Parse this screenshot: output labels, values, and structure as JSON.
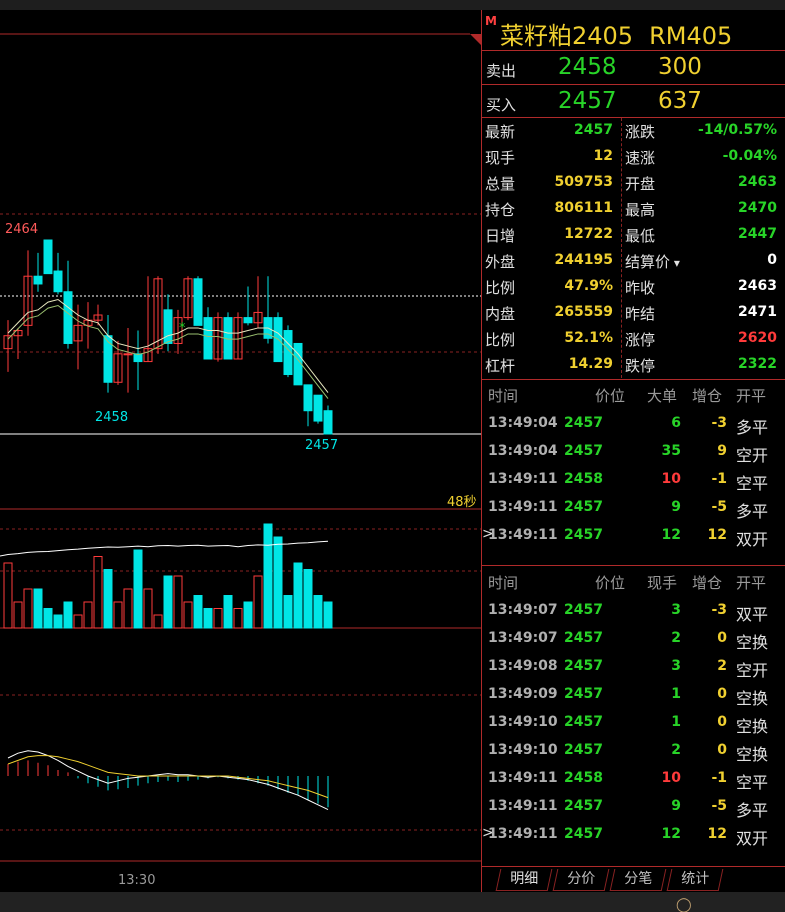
{
  "header": {
    "badge": "M",
    "name": "菜籽粕2405",
    "code": "RM405"
  },
  "quote": {
    "sell": {
      "label": "卖出",
      "price": "2458",
      "volume": "300"
    },
    "buy": {
      "label": "买入",
      "price": "2457",
      "volume": "637"
    }
  },
  "stats_left": [
    {
      "label": "最新",
      "value": "2457",
      "color": "green"
    },
    {
      "label": "现手",
      "value": "12",
      "color": "yellow"
    },
    {
      "label": "总量",
      "value": "509753",
      "color": "yellow"
    },
    {
      "label": "持仓",
      "value": "806111",
      "color": "yellow"
    },
    {
      "label": "日增",
      "value": "12722",
      "color": "yellow"
    },
    {
      "label": "外盘",
      "value": "244195",
      "color": "yellow"
    },
    {
      "label": "比例",
      "value": "47.9%",
      "color": "yellow"
    },
    {
      "label": "内盘",
      "value": "265559",
      "color": "yellow"
    },
    {
      "label": "比例",
      "value": "52.1%",
      "color": "yellow"
    },
    {
      "label": "杠杆",
      "value": "14.29",
      "color": "yellow"
    }
  ],
  "stats_right": [
    {
      "label": "涨跌",
      "value": "-14/0.57%",
      "color": "green"
    },
    {
      "label": "速涨",
      "value": "-0.04%",
      "color": "green"
    },
    {
      "label": "开盘",
      "value": "2463",
      "color": "green"
    },
    {
      "label": "最高",
      "value": "2470",
      "color": "green"
    },
    {
      "label": "最低",
      "value": "2447",
      "color": "green"
    },
    {
      "label": "结算价",
      "value": "0",
      "color": "white",
      "dropdown": true
    },
    {
      "label": "昨收",
      "value": "2463",
      "color": "white"
    },
    {
      "label": "昨结",
      "value": "2471",
      "color": "white"
    },
    {
      "label": "涨停",
      "value": "2620",
      "color": "red"
    },
    {
      "label": "跌停",
      "value": "2322",
      "color": "green"
    }
  ],
  "big_orders": {
    "headers": [
      "时间",
      "价位",
      "大单",
      "增仓",
      "开平"
    ],
    "rows": [
      {
        "time": "13:49:04",
        "price": "2457",
        "price_color": "green",
        "qty": "6",
        "qty_color": "green",
        "delta": "-3",
        "type": "多平",
        "current": false
      },
      {
        "time": "13:49:04",
        "price": "2457",
        "price_color": "green",
        "qty": "35",
        "qty_color": "green",
        "delta": "9",
        "type": "空开",
        "current": false
      },
      {
        "time": "13:49:11",
        "price": "2458",
        "price_color": "green",
        "qty": "10",
        "qty_color": "red",
        "delta": "-1",
        "type": "空平",
        "current": false
      },
      {
        "time": "13:49:11",
        "price": "2457",
        "price_color": "green",
        "qty": "9",
        "qty_color": "green",
        "delta": "-5",
        "type": "多平",
        "current": false
      },
      {
        "time": "13:49:11",
        "price": "2457",
        "price_color": "green",
        "qty": "12",
        "qty_color": "green",
        "delta": "12",
        "type": "双开",
        "current": true
      }
    ]
  },
  "ticks": {
    "headers": [
      "时间",
      "价位",
      "现手",
      "增仓",
      "开平"
    ],
    "rows": [
      {
        "time": "13:49:07",
        "price": "2457",
        "price_color": "green",
        "qty": "3",
        "qty_color": "green",
        "delta": "-3",
        "type": "双平",
        "current": false
      },
      {
        "time": "13:49:07",
        "price": "2457",
        "price_color": "green",
        "qty": "2",
        "qty_color": "green",
        "delta": "0",
        "type": "空换",
        "current": false
      },
      {
        "time": "13:49:08",
        "price": "2457",
        "price_color": "green",
        "qty": "3",
        "qty_color": "green",
        "delta": "2",
        "type": "空开",
        "current": false
      },
      {
        "time": "13:49:09",
        "price": "2457",
        "price_color": "green",
        "qty": "1",
        "qty_color": "green",
        "delta": "0",
        "type": "空换",
        "current": false
      },
      {
        "time": "13:49:10",
        "price": "2457",
        "price_color": "green",
        "qty": "1",
        "qty_color": "green",
        "delta": "0",
        "type": "空换",
        "current": false
      },
      {
        "time": "13:49:10",
        "price": "2457",
        "price_color": "green",
        "qty": "2",
        "qty_color": "green",
        "delta": "0",
        "type": "空换",
        "current": false
      },
      {
        "time": "13:49:11",
        "price": "2458",
        "price_color": "green",
        "qty": "10",
        "qty_color": "red",
        "delta": "-1",
        "type": "空平",
        "current": false
      },
      {
        "time": "13:49:11",
        "price": "2457",
        "price_color": "green",
        "qty": "9",
        "qty_color": "green",
        "delta": "-5",
        "type": "多平",
        "current": false
      },
      {
        "time": "13:49:11",
        "price": "2457",
        "price_color": "green",
        "qty": "12",
        "qty_color": "green",
        "delta": "12",
        "type": "双开",
        "current": true
      }
    ]
  },
  "tabs": [
    "明细",
    "分价",
    "分笔",
    "统计"
  ],
  "chart": {
    "high_label": "2464",
    "low_label": "2458",
    "last_label": "2457",
    "countdown": "48秒",
    "time_axis": "13:30",
    "colors": {
      "up": "#ff3b3b",
      "down": "#00e5e5",
      "ma": "#e8e8c0",
      "grid": "#8a2222"
    }
  },
  "chart_data": {
    "type": "candlestick",
    "candles": [
      {
        "o": 2459.8,
        "h": 2460.9,
        "l": 2458.9,
        "c": 2460.3
      },
      {
        "o": 2460.3,
        "h": 2460.6,
        "l": 2459.4,
        "c": 2460.5
      },
      {
        "o": 2460.7,
        "h": 2463.6,
        "l": 2460.3,
        "c": 2462.6
      },
      {
        "o": 2462.6,
        "h": 2463.5,
        "l": 2462.0,
        "c": 2462.3
      },
      {
        "o": 2464.0,
        "h": 2464.0,
        "l": 2462.7,
        "c": 2462.7
      },
      {
        "o": 2462.8,
        "h": 2463.5,
        "l": 2461.9,
        "c": 2462.0
      },
      {
        "o": 2462.0,
        "h": 2463.2,
        "l": 2459.8,
        "c": 2460.0
      },
      {
        "o": 2460.1,
        "h": 2461.5,
        "l": 2459.0,
        "c": 2460.7
      },
      {
        "o": 2460.7,
        "h": 2461.6,
        "l": 2459.8,
        "c": 2460.9
      },
      {
        "o": 2460.9,
        "h": 2461.5,
        "l": 2460.7,
        "c": 2461.1
      },
      {
        "o": 2460.3,
        "h": 2461.1,
        "l": 2458.1,
        "c": 2458.5
      },
      {
        "o": 2458.5,
        "h": 2460.1,
        "l": 2458.4,
        "c": 2459.6
      },
      {
        "o": 2459.6,
        "h": 2460.6,
        "l": 2458.1,
        "c": 2459.6
      },
      {
        "o": 2459.6,
        "h": 2460.5,
        "l": 2458.2,
        "c": 2459.3
      },
      {
        "o": 2459.3,
        "h": 2462.6,
        "l": 2459.3,
        "c": 2459.8
      },
      {
        "o": 2459.8,
        "h": 2462.6,
        "l": 2459.6,
        "c": 2462.5
      },
      {
        "o": 2461.3,
        "h": 2461.9,
        "l": 2459.7,
        "c": 2460.0
      },
      {
        "o": 2460.0,
        "h": 2461.3,
        "l": 2459.6,
        "c": 2461.0
      },
      {
        "o": 2461.0,
        "h": 2462.6,
        "l": 2460.9,
        "c": 2462.5
      },
      {
        "o": 2462.5,
        "h": 2462.6,
        "l": 2460.7,
        "c": 2460.7
      },
      {
        "o": 2461.0,
        "h": 2461.4,
        "l": 2459.4,
        "c": 2459.4
      },
      {
        "o": 2459.4,
        "h": 2461.2,
        "l": 2459.3,
        "c": 2461.0
      },
      {
        "o": 2461.0,
        "h": 2461.2,
        "l": 2459.4,
        "c": 2459.4
      },
      {
        "o": 2459.4,
        "h": 2461.2,
        "l": 2459.4,
        "c": 2461.0
      },
      {
        "o": 2461.0,
        "h": 2462.2,
        "l": 2460.7,
        "c": 2460.8
      },
      {
        "o": 2460.8,
        "h": 2462.6,
        "l": 2460.6,
        "c": 2461.2
      },
      {
        "o": 2461.0,
        "h": 2462.6,
        "l": 2460.0,
        "c": 2460.2
      },
      {
        "o": 2461.0,
        "h": 2461.2,
        "l": 2459.3,
        "c": 2459.3
      },
      {
        "o": 2460.5,
        "h": 2460.7,
        "l": 2458.7,
        "c": 2458.8
      },
      {
        "o": 2460.0,
        "h": 2460.0,
        "l": 2458.4,
        "c": 2458.4
      },
      {
        "o": 2458.4,
        "h": 2458.4,
        "l": 2456.8,
        "c": 2457.4
      },
      {
        "o": 2458.0,
        "h": 2458.0,
        "l": 2456.9,
        "c": 2457.0
      },
      {
        "o": 2457.4,
        "h": 2457.6,
        "l": 2456.5,
        "c": 2456.5
      }
    ],
    "ma": [
      2460.4,
      2460.8,
      2461.2,
      2461.3,
      2461.6,
      2461.7,
      2461.4,
      2461.1,
      2460.9,
      2460.8,
      2460.3,
      2460.0,
      2459.9,
      2459.8,
      2459.9,
      2460.1,
      2460.3,
      2460.4,
      2460.6,
      2460.6,
      2460.5,
      2460.5,
      2460.4,
      2460.4,
      2460.5,
      2460.6,
      2460.6,
      2460.4,
      2460.0,
      2459.6,
      2459.1,
      2458.6,
      2458.1
    ],
    "volume": [
      50,
      20,
      30,
      30,
      15,
      10,
      20,
      10,
      20,
      55,
      45,
      20,
      30,
      60,
      30,
      10,
      40,
      40,
      20,
      25,
      15,
      15,
      25,
      15,
      20,
      40,
      80,
      70,
      25,
      50,
      45,
      25,
      20
    ],
    "open_interest": [
      3.5,
      3.8,
      4.2,
      4.4,
      4.5,
      4.8,
      5.1,
      5.3,
      5.6,
      5.8,
      6.0,
      5.9,
      6.1,
      6.3,
      6.1,
      6.4,
      6.5,
      6.3,
      6.5,
      6.6,
      6.3,
      6.4,
      6.5,
      6.1,
      6.5,
      6.7,
      6.6,
      6.9,
      7.0,
      7.3,
      7.4,
      7.7,
      7.9
    ],
    "macd_hist": [
      1.0,
      1.2,
      1.3,
      1.1,
      0.9,
      0.5,
      0.3,
      -0.2,
      -0.6,
      -0.9,
      -1.2,
      -1.1,
      -1.0,
      -0.8,
      -0.6,
      -0.5,
      -0.4,
      -0.5,
      -0.4,
      -0.3,
      -0.2,
      -0.1,
      -0.2,
      -0.3,
      -0.4,
      -0.6,
      -0.8,
      -1.1,
      -1.4,
      -1.6,
      -2.0,
      -2.3,
      -2.6
    ],
    "macd_dif": [
      1.5,
      1.9,
      2.1,
      2.0,
      1.7,
      1.3,
      0.8,
      0.4,
      0.0,
      -0.3,
      -0.6,
      -0.4,
      -0.2,
      -0.1,
      0.0,
      0.1,
      0.2,
      0.1,
      0.1,
      0.0,
      -0.1,
      0.0,
      -0.1,
      -0.2,
      -0.3,
      -0.5,
      -0.7,
      -1.0,
      -1.3,
      -1.6,
      -2.0,
      -2.4,
      -2.8
    ],
    "macd_dea": [
      1.0,
      1.3,
      1.6,
      1.7,
      1.7,
      1.6,
      1.4,
      1.2,
      0.9,
      0.6,
      0.3,
      0.2,
      0.1,
      0.0,
      0.0,
      0.0,
      0.0,
      0.0,
      0.0,
      0.0,
      0.0,
      0.0,
      0.0,
      -0.1,
      -0.2,
      -0.3,
      -0.4,
      -0.6,
      -0.8,
      -1.0,
      -1.2,
      -1.5,
      -1.8
    ]
  }
}
